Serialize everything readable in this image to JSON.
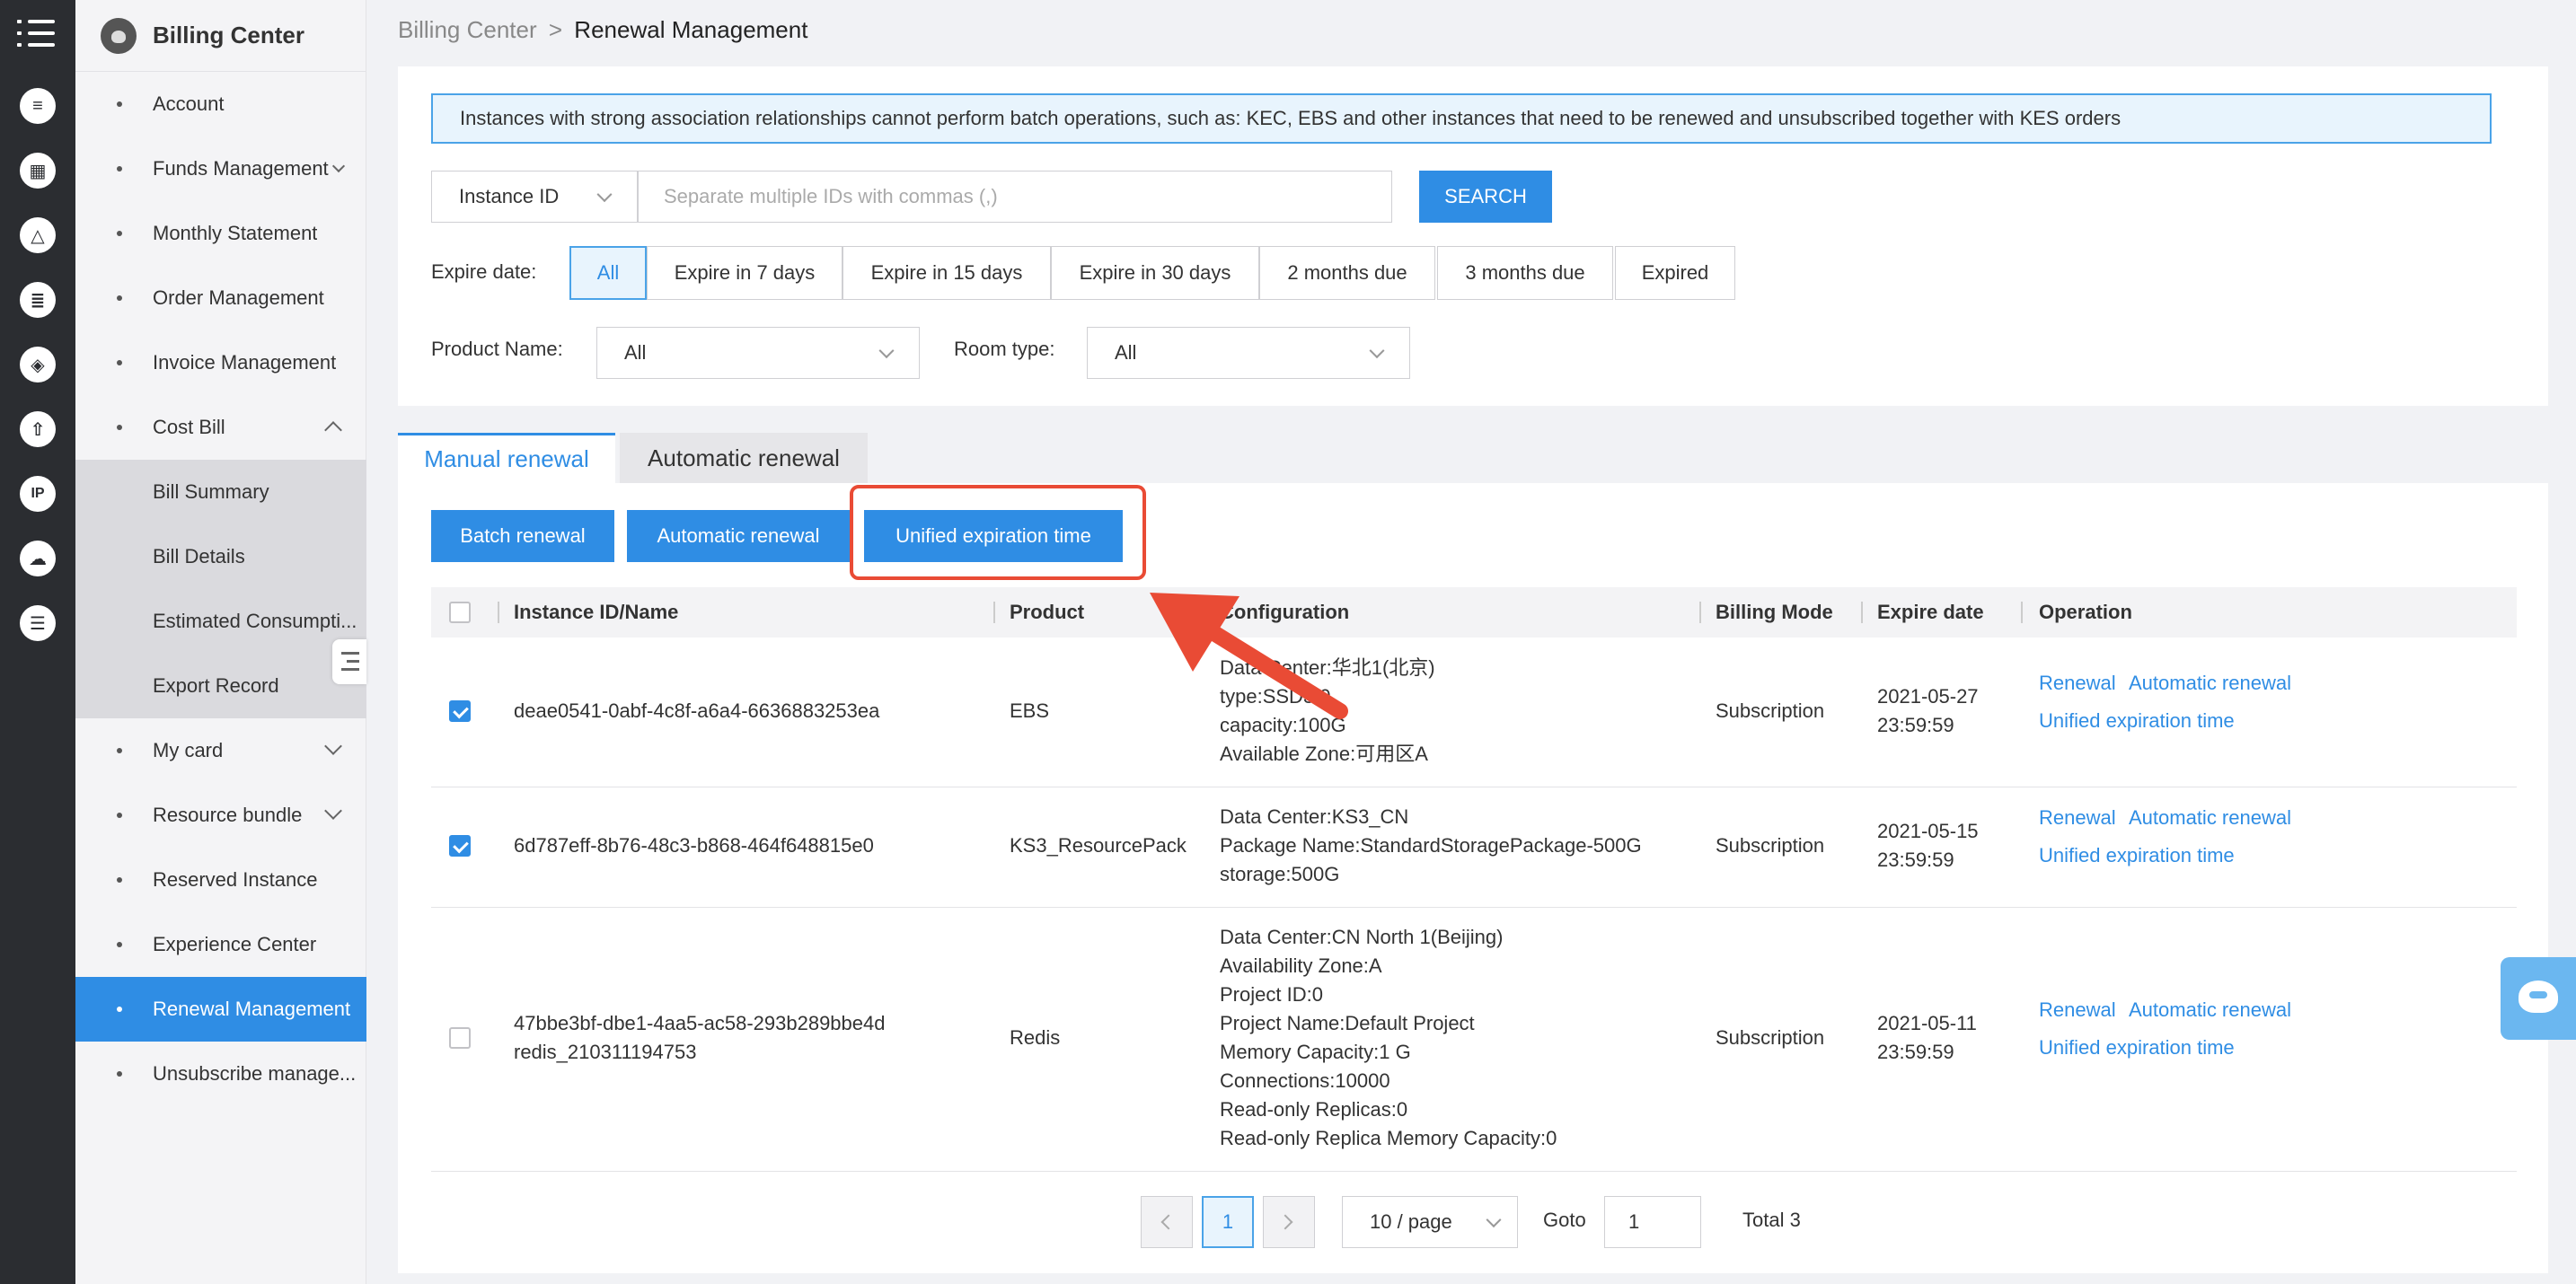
{
  "breadcrumb": {
    "root": "Billing Center",
    "sep": ">",
    "current": "Renewal Management"
  },
  "sidebar": {
    "title": "Billing Center",
    "items": [
      {
        "label": "Account"
      },
      {
        "label": "Funds Management"
      },
      {
        "label": "Monthly Statement"
      },
      {
        "label": "Order Management"
      },
      {
        "label": "Invoice Management"
      },
      {
        "label": "Cost Bill"
      },
      {
        "label": "Bill Summary"
      },
      {
        "label": "Bill Details"
      },
      {
        "label": "Estimated Consumpti..."
      },
      {
        "label": "Export Record"
      },
      {
        "label": "My card"
      },
      {
        "label": "Resource bundle"
      },
      {
        "label": "Reserved Instance"
      },
      {
        "label": "Experience Center"
      },
      {
        "label": "Renewal Management"
      },
      {
        "label": "Unsubscribe manage..."
      }
    ]
  },
  "notice": "Instances with strong association relationships cannot perform batch operations, such as: KEC, EBS and other instances that need to be renewed and unsubscribed together with KES orders",
  "search": {
    "type": "Instance ID",
    "placeholder": "Separate multiple IDs with commas (,)",
    "button": "SEARCH"
  },
  "expire": {
    "label": "Expire date:",
    "options": [
      "All",
      "Expire in 7 days",
      "Expire in 15 days",
      "Expire in 30 days",
      "2 months due",
      "3 months due",
      "Expired"
    ],
    "selected": "All"
  },
  "filters": {
    "product_label": "Product Name:",
    "product_value": "All",
    "room_label": "Room type:",
    "room_value": "All"
  },
  "tabs": [
    "Manual renewal",
    "Automatic renewal"
  ],
  "actions": [
    "Batch renewal",
    "Automatic renewal",
    "Unified expiration time"
  ],
  "table": {
    "headers": [
      "Instance ID/Name",
      "Product",
      "Configuration",
      "Billing Mode",
      "Expire date",
      "Operation"
    ],
    "rows": [
      {
        "checked": true,
        "id": "deae0541-0abf-4c8f-a6a4-6636883253ea",
        "name": "",
        "product": "EBS",
        "config": [
          "Data Center:华北1(北京)",
          "type:SSD3.0",
          "capacity:100G",
          "Available Zone:可用区A"
        ],
        "billing": "Subscription",
        "date": "2021-05-27",
        "time": "23:59:59",
        "ops": [
          "Renewal",
          "Automatic renewal",
          "Unified expiration time"
        ]
      },
      {
        "checked": true,
        "id": "6d787eff-8b76-48c3-b868-464f648815e0",
        "name": "",
        "product": "KS3_ResourcePack",
        "config": [
          "Data Center:KS3_CN",
          "Package Name:StandardStoragePackage-500G",
          "storage:500G"
        ],
        "billing": "Subscription",
        "date": "2021-05-15",
        "time": "23:59:59",
        "ops": [
          "Renewal",
          "Automatic renewal",
          "Unified expiration time"
        ]
      },
      {
        "checked": false,
        "id": "47bbe3bf-dbe1-4aa5-ac58-293b289bbe4d",
        "name": "redis_210311194753",
        "product": "Redis",
        "config": [
          "Data Center:CN North 1(Beijing)",
          "Availability Zone:A",
          "Project ID:0",
          "Project Name:Default Project",
          "Memory Capacity:1 G",
          "Connections:10000",
          "Read-only Replicas:0",
          "Read-only Replica Memory Capacity:0"
        ],
        "billing": "Subscription",
        "date": "2021-05-11",
        "time": "23:59:59",
        "ops": [
          "Renewal",
          "Automatic renewal",
          "Unified expiration time"
        ]
      }
    ]
  },
  "pagination": {
    "page": "1",
    "page_size": "10 / page",
    "goto_label": "Goto",
    "goto_value": "1",
    "total": "Total 3"
  },
  "colors": {
    "accent": "#2f8de4",
    "highlight": "#e94b35",
    "rail": "#2b2d31"
  }
}
